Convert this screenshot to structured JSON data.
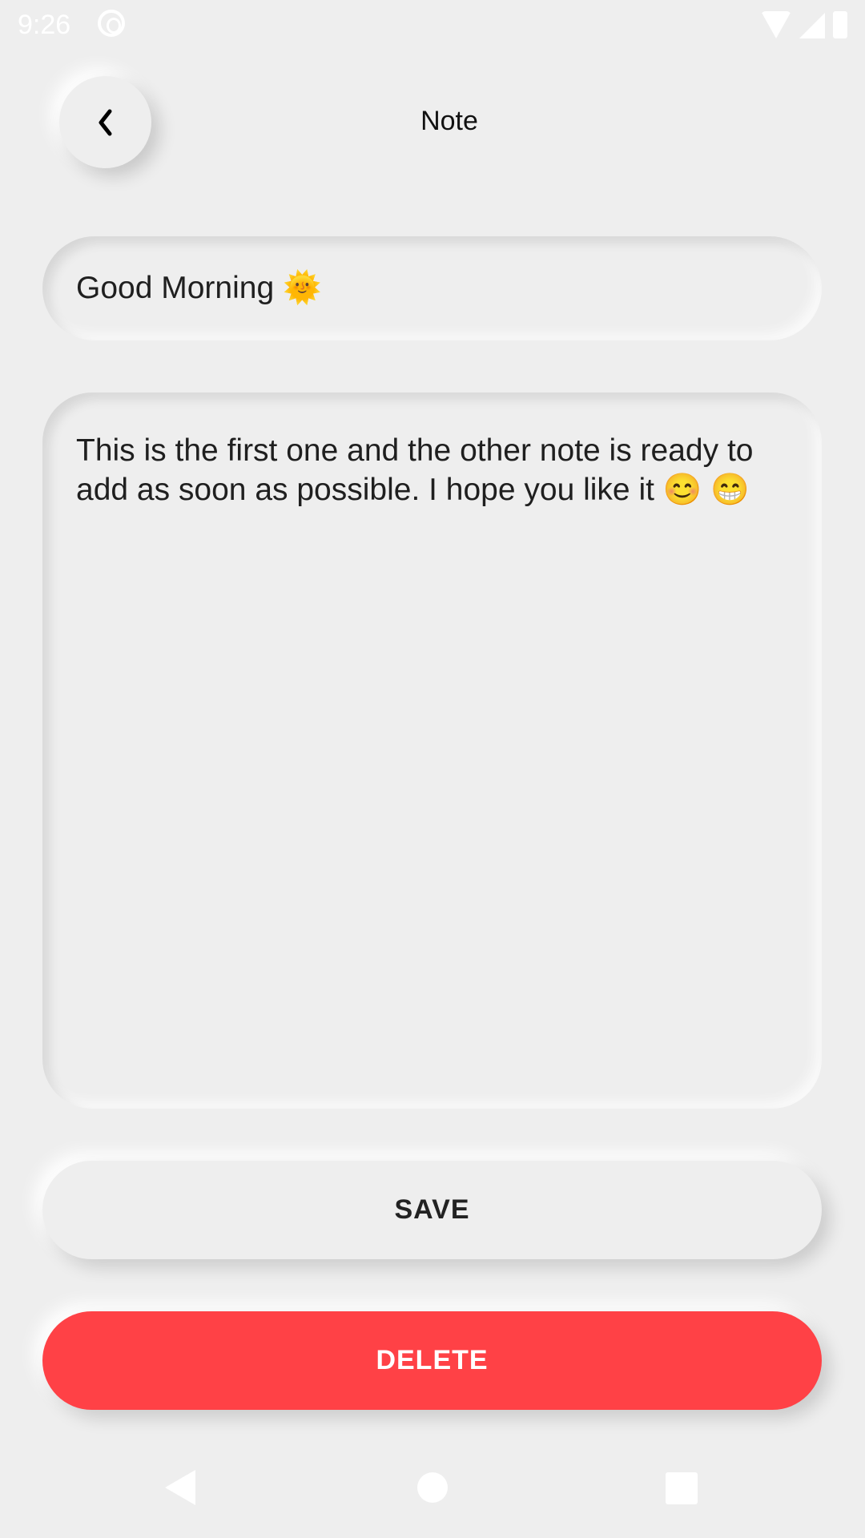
{
  "status_bar": {
    "time": "9:26"
  },
  "header": {
    "title": "Note"
  },
  "note": {
    "title": "Good Morning 🌞",
    "body": "This is the first one and the other note is ready to add as soon as possible. I hope you like it 😊 😁"
  },
  "actions": {
    "save_label": "SAVE",
    "delete_label": "DELETE"
  },
  "colors": {
    "background": "#eeeeee",
    "delete": "#ff4146"
  }
}
